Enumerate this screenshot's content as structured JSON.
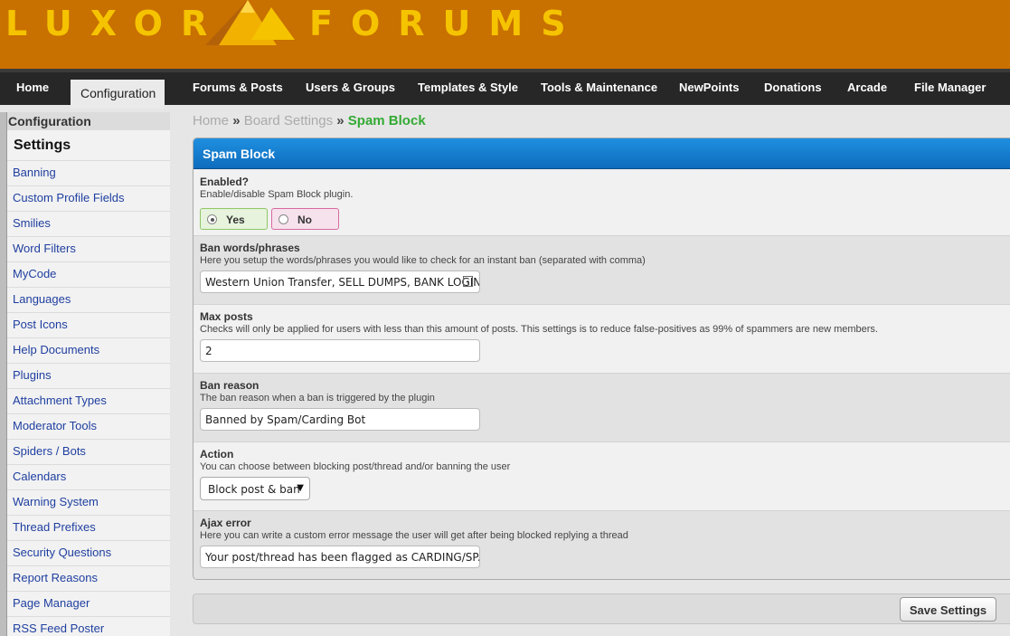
{
  "header": {
    "logo_left": "LUXOR",
    "logo_right": "FORUMS",
    "colors": {
      "background": "#c87000",
      "logo": "#f5c300"
    }
  },
  "nav": {
    "items": [
      "Home",
      "Configuration",
      "Forums & Posts",
      "Users & Groups",
      "Templates & Style",
      "Tools & Maintenance",
      "NewPoints",
      "Donations",
      "Arcade",
      "File Manager"
    ],
    "active": "Configuration"
  },
  "sidebar": {
    "heading": "Configuration",
    "section": "Settings",
    "items": [
      "Banning",
      "Custom Profile Fields",
      "Smilies",
      "Word Filters",
      "MyCode",
      "Languages",
      "Post Icons",
      "Help Documents",
      "Plugins",
      "Attachment Types",
      "Moderator Tools",
      "Spiders / Bots",
      "Calendars",
      "Warning System",
      "Thread Prefixes",
      "Security Questions",
      "Report Reasons",
      "Page Manager",
      "RSS Feed Poster"
    ]
  },
  "breadcrumb": {
    "items": [
      "Home",
      "Board Settings"
    ],
    "separator": "»",
    "current": "Spam Block"
  },
  "panel": {
    "title": "Spam Block",
    "enabled": {
      "title": "Enabled?",
      "desc": "Enable/disable Spam Block plugin.",
      "yes_label": "Yes",
      "no_label": "No",
      "selected": "Yes"
    },
    "ban_words": {
      "title": "Ban words/phrases",
      "desc": "Here you setup the words/phrases you would like to check for an instant ban (separated with comma)",
      "value": "Western Union Transfer, SELL DUMPS, BANK LOGIN"
    },
    "max_posts": {
      "title": "Max posts",
      "desc": "Checks will only be applied for users with less than this amount of posts. This settings is to reduce false-positives as 99% of spammers are new members.",
      "value": "2"
    },
    "ban_reason": {
      "title": "Ban reason",
      "desc": "The ban reason when a ban is triggered by the plugin",
      "value": "Banned by Spam/Carding Bot"
    },
    "action": {
      "title": "Action",
      "desc": "You can choose between blocking post/thread and/or banning the user",
      "selected": "Block post & ban"
    },
    "ajax_error": {
      "title": "Ajax error",
      "desc": "Here you can write a custom error message the user will get after being blocked replying a thread",
      "value": "Your post/thread has been flagged as CARDING/SPAM"
    }
  },
  "footer": {
    "save_label": "Save Settings"
  }
}
